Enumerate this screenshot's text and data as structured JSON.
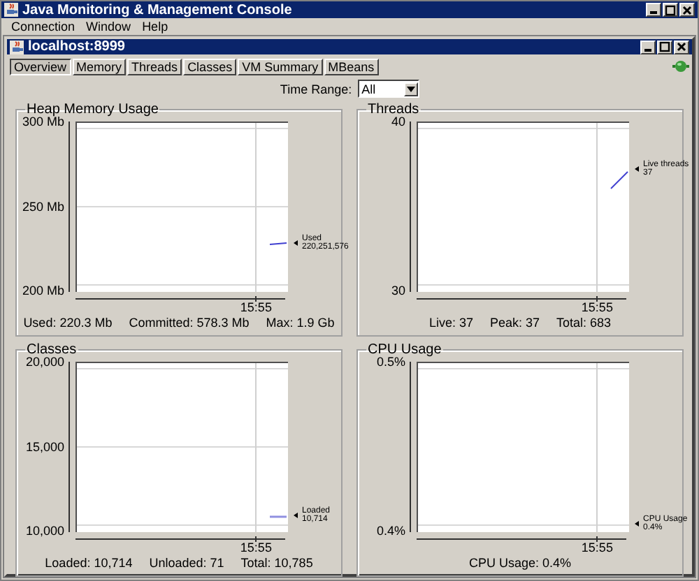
{
  "window": {
    "title": "Java Monitoring & Management Console"
  },
  "menu": [
    {
      "label": "Connection"
    },
    {
      "label": "Window"
    },
    {
      "label": "Help"
    }
  ],
  "internal_frame": {
    "title": "localhost:8999"
  },
  "tabs": [
    {
      "label": "Overview",
      "selected": true
    },
    {
      "label": "Memory",
      "selected": false
    },
    {
      "label": "Threads",
      "selected": false
    },
    {
      "label": "Classes",
      "selected": false
    },
    {
      "label": "VM Summary",
      "selected": false
    },
    {
      "label": "MBeans",
      "selected": false
    }
  ],
  "time_range": {
    "label": "Time Range:",
    "value": "All"
  },
  "panels": [
    {
      "title": "Heap Memory Usage",
      "y_ticks": [
        "300 Mb",
        "250 Mb",
        "200 Mb"
      ],
      "x_tick": "15:55",
      "legend": [
        "Used",
        "220,251,576"
      ],
      "kind": "flat-mid",
      "stats": [
        "Used: 220.3 Mb",
        "Committed: 578.3 Mb",
        "Max: 1.9 Gb"
      ]
    },
    {
      "title": "Threads",
      "y_ticks": [
        "40",
        "30"
      ],
      "x_tick": "15:55",
      "legend": [
        "Live threads",
        "37"
      ],
      "kind": "rising",
      "stats": [
        "Live: 37",
        "Peak: 37",
        "Total: 683"
      ]
    },
    {
      "title": "Classes",
      "y_ticks": [
        "20,000",
        "15,000",
        "10,000"
      ],
      "x_tick": "15:55",
      "legend": [
        "Loaded",
        "10,714"
      ],
      "kind": "flat-low",
      "stats": [
        "Loaded: 10,714",
        "Unloaded: 71",
        "Total: 10,785"
      ]
    },
    {
      "title": "CPU Usage",
      "y_ticks": [
        "0.5%",
        "0.4%"
      ],
      "x_tick": "15:55",
      "legend": [
        "CPU Usage",
        "0.4%"
      ],
      "kind": "baseline",
      "stats": [
        "CPU Usage: 0.4%"
      ]
    }
  ]
}
